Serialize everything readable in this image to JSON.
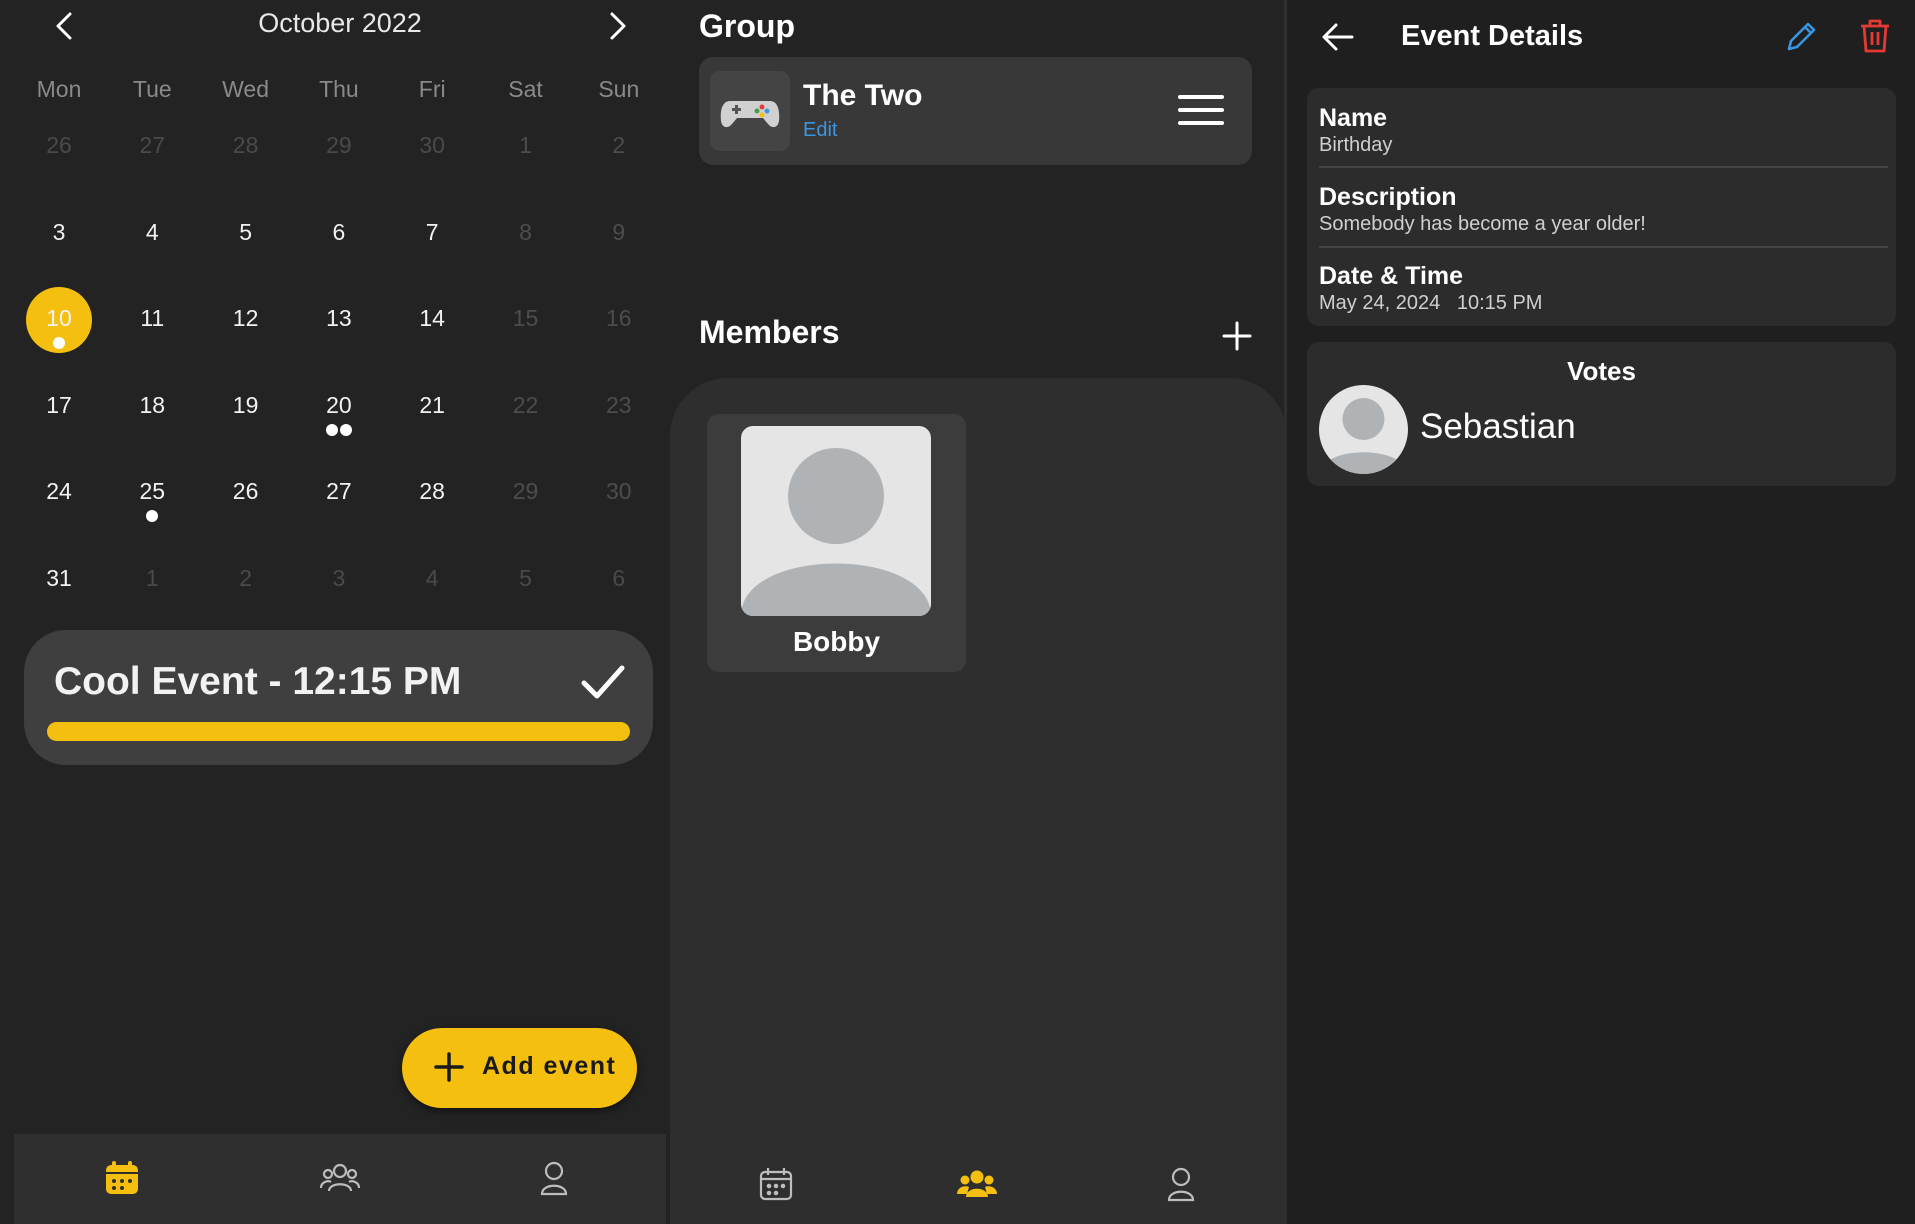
{
  "calendar": {
    "month_title": "October 2022",
    "weekdays": [
      "Mon",
      "Tue",
      "Wed",
      "Thu",
      "Fri",
      "Sat",
      "Sun"
    ],
    "weeks": [
      [
        "26",
        "27",
        "28",
        "29",
        "30",
        "1",
        "2"
      ],
      [
        "3",
        "4",
        "5",
        "6",
        "7",
        "8",
        "9"
      ],
      [
        "10",
        "11",
        "12",
        "13",
        "14",
        "15",
        "16"
      ],
      [
        "17",
        "18",
        "19",
        "20",
        "21",
        "22",
        "23"
      ],
      [
        "24",
        "25",
        "26",
        "27",
        "28",
        "29",
        "30"
      ],
      [
        "31",
        "1",
        "2",
        "3",
        "4",
        "5",
        "6"
      ]
    ],
    "selected_day": "10",
    "event_dots": {
      "10": 1,
      "20": 2,
      "25": 1
    },
    "event_card": {
      "title": "Cool Event - 12:15 PM",
      "progress": 1.0
    },
    "add_event_label": "Add event",
    "accent_color": "#f5bf10",
    "nav_icons": [
      "calendar-icon",
      "group-icon",
      "profile-icon"
    ]
  },
  "group": {
    "section_title": "Group",
    "name": "The Two",
    "edit_label": "Edit",
    "avatar_icon": "gamepad-icon",
    "members_title": "Members",
    "members": [
      {
        "name": "Bobby"
      }
    ]
  },
  "event_details": {
    "title": "Event Details",
    "fields": [
      {
        "label": "Name",
        "value": "Birthday"
      },
      {
        "label": "Description",
        "value": "Somebody has become a year older!"
      },
      {
        "label": "Date & Time",
        "value": "May 24, 2024   10:15 PM"
      }
    ],
    "votes_title": "Votes",
    "voters": [
      {
        "name": "Sebastian"
      }
    ],
    "edit_color": "#3a96e0",
    "delete_color": "#e53935"
  }
}
